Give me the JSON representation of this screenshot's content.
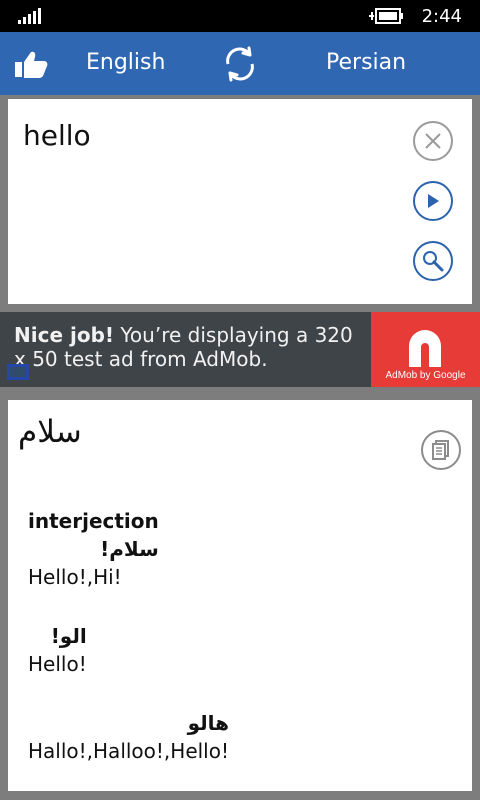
{
  "status_bar": {
    "time": "2:44"
  },
  "topbar": {
    "source_language": "English",
    "target_language": "Persian"
  },
  "translator": {
    "input_text": "hello",
    "translation": "سلام"
  },
  "ad": {
    "headline": "Nice job!",
    "body": "You’re displaying a 320 x 50 test ad from AdMob.",
    "logo_caption": "AdMob by Google"
  },
  "dictionary": {
    "part_of_speech": "interjection",
    "entries": [
      {
        "term": "سلام!",
        "meaning": "Hello!,Hi!"
      },
      {
        "term": "الو!",
        "meaning": "Hello!"
      },
      {
        "term": "هالو",
        "meaning": "Hallo!,Halloo!,Hello!"
      }
    ]
  },
  "colors": {
    "header_blue": "#2f67b3",
    "button_blue": "#2b63ac",
    "ad_red": "#e63b37",
    "ad_dark": "#3f4448"
  },
  "icons": {
    "like": "thumb-up-icon",
    "swap": "swap-languages-icon",
    "clear": "close-icon",
    "play": "play-icon",
    "search": "search-icon",
    "copy": "copy-icon",
    "info": "info-icon"
  }
}
